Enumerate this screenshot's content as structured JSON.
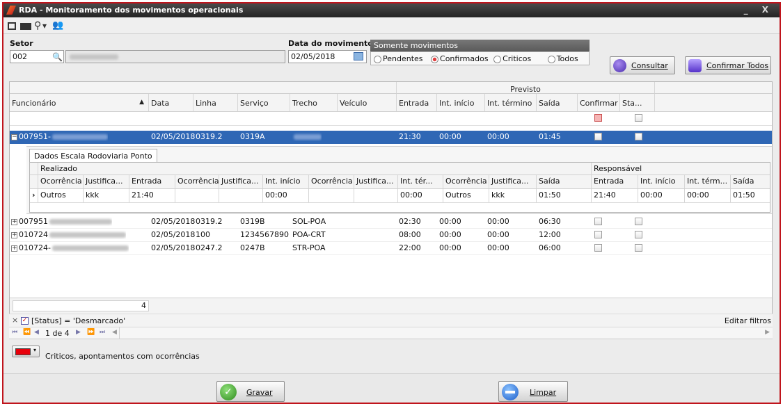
{
  "window": {
    "title": "RDA - Monitoramento dos movimentos operacionais",
    "controls": "_ X"
  },
  "toolbar": {
    "icons": [
      "exit-icon",
      "report-icon",
      "search-icon",
      "users-icon"
    ],
    "dropdown_glyph": "▾"
  },
  "filters": {
    "setor_label": "Setor",
    "setor_value": "002",
    "data_label": "Data do movimento",
    "data_value": "02/05/2018",
    "somente_label": "Somente movimentos",
    "options": [
      "Pendentes",
      "Confirmados",
      "Criticos",
      "Todos"
    ],
    "selected": "Confirmados",
    "consultar": "Consultar",
    "confirmar_todos": "Confirmar Todos"
  },
  "grid": {
    "group_header": "Previsto",
    "columns": [
      "Funcionário",
      "▲",
      "Data",
      "Linha",
      "Serviço",
      "Trecho",
      "Veículo",
      "Entrada",
      "Int. início",
      "Int. término",
      "Saída",
      "Confirmar",
      "Sta..."
    ],
    "rows": [
      {
        "func": "007951-",
        "data": "02/05/2018",
        "linha": "0319.2",
        "servico": "0319A",
        "trecho": "",
        "veiculo": "",
        "entrada": "21:30",
        "int_inicio": "00:00",
        "int_termino": "00:00",
        "saida": "01:45",
        "expand": "−",
        "selected": true
      },
      {
        "func": "007951",
        "data": "02/05/2018",
        "linha": "0319.2",
        "servico": "0319B",
        "trecho": "SOL-POA",
        "veiculo": "",
        "entrada": "02:30",
        "int_inicio": "00:00",
        "int_termino": "00:00",
        "saida": "06:30",
        "expand": "+",
        "selected": false
      },
      {
        "func": "010724",
        "data": "02/05/2018",
        "linha": "100",
        "servico": "1234567890",
        "trecho": "POA-CRT",
        "veiculo": "",
        "entrada": "08:00",
        "int_inicio": "00:00",
        "int_termino": "00:00",
        "saida": "12:00",
        "expand": "+",
        "selected": false
      },
      {
        "func": "010724-",
        "data": "02/05/2018",
        "linha": "0247.2",
        "servico": "0247B",
        "trecho": "STR-POA",
        "veiculo": "",
        "entrada": "22:00",
        "int_inicio": "00:00",
        "int_termino": "00:00",
        "saida": "06:00",
        "expand": "+",
        "selected": false
      }
    ],
    "count": "4"
  },
  "detail": {
    "tab": "Dados Escala Rodoviaria Ponto",
    "group_realizado": "Realizado",
    "group_responsavel": "Responsável",
    "columns": [
      "Ocorrência",
      "Justifica...",
      "Entrada",
      "Ocorrência",
      "Justifica...",
      "Int. início",
      "Ocorrência",
      "Justifica...",
      "Int. tér...",
      "Ocorrência",
      "Justifica...",
      "Saída",
      "Entrada",
      "Int. início",
      "Int. térm...",
      "Saída"
    ],
    "row": [
      "Outros",
      "kkk",
      "21:40",
      "",
      "",
      "00:00",
      "",
      "",
      "00:00",
      "Outros",
      "kkk",
      "01:50",
      "21:40",
      "00:00",
      "00:00",
      "01:50"
    ],
    "row_indicator": "›"
  },
  "filterbar": {
    "close": "×",
    "text": "[Status] = 'Desmarcado'",
    "edit": "Editar filtros"
  },
  "navbar": {
    "first": "⏮",
    "prev_page": "⏪",
    "prev": "◀",
    "page": "1 de 4",
    "next": "▶",
    "next_page": "⏩",
    "last": "⏭"
  },
  "legend": {
    "color": "#e8000b",
    "text": "Criticos, apontamentos com ocorrências"
  },
  "actions": {
    "gravar": "Gravar",
    "limpar": "Limpar"
  }
}
